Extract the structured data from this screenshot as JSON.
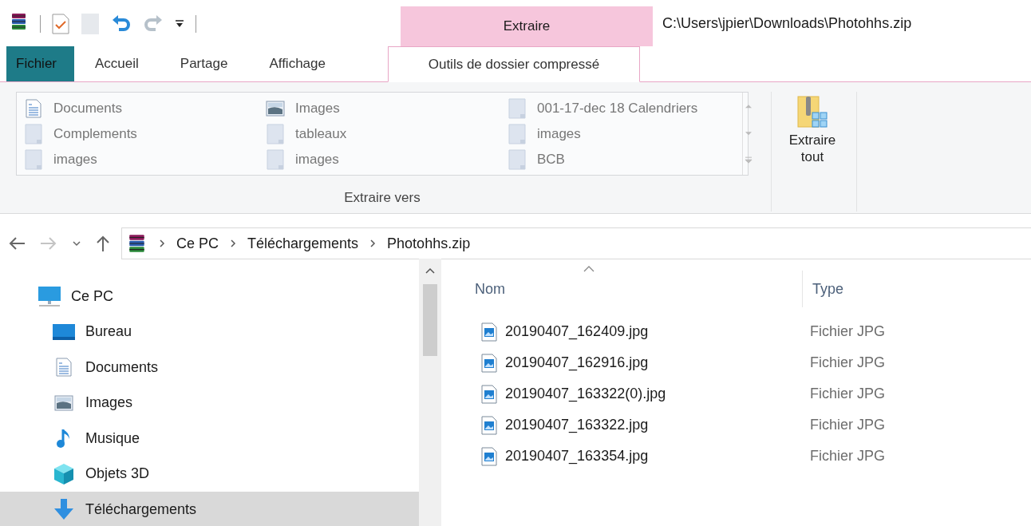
{
  "quick_access": [
    {
      "kind": "archive",
      "disabled": false
    },
    {
      "kind": "properties",
      "disabled": false
    },
    {
      "kind": "page",
      "disabled": true
    },
    {
      "kind": "undo",
      "disabled": false
    },
    {
      "kind": "redo",
      "disabled": true
    },
    {
      "kind": "customize",
      "disabled": false
    }
  ],
  "context_tab_group": "Extraire",
  "window": {
    "title": "C:\\Users\\jpier\\Downloads\\Photohhs.zip"
  },
  "tabs": [
    {
      "label": "Fichier",
      "kind": "file",
      "selected": false
    },
    {
      "label": "Accueil",
      "kind": "tab",
      "selected": false
    },
    {
      "label": "Partage",
      "kind": "tab",
      "selected": false
    },
    {
      "label": "Affichage",
      "kind": "tab",
      "selected": false
    },
    {
      "label": "Outils de dossier compressé",
      "kind": "context",
      "selected": true
    }
  ],
  "ribbon": {
    "gallery": [
      [
        {
          "label": "Documents",
          "kind": "documents"
        },
        {
          "label": "Complements",
          "kind": "folder"
        },
        {
          "label": "images",
          "kind": "folder"
        }
      ],
      [
        {
          "label": "Images",
          "kind": "images"
        },
        {
          "label": "tableaux",
          "kind": "folder"
        },
        {
          "label": "images",
          "kind": "folder"
        }
      ],
      [
        {
          "label": "001-17-dec 18 Calendriers",
          "kind": "folder"
        },
        {
          "label": "images",
          "kind": "folder"
        },
        {
          "label": "BCB",
          "kind": "folder"
        }
      ]
    ],
    "group_label": "Extraire vers",
    "extract_all": "Extraire tout"
  },
  "navigation": [
    {
      "kind": "back",
      "disabled": false
    },
    {
      "kind": "forward",
      "disabled": true
    },
    {
      "kind": "recent",
      "disabled": false
    },
    {
      "kind": "up",
      "disabled": false
    }
  ],
  "breadcrumb": [
    "Ce PC",
    "Téléchargements",
    "Photohhs.zip"
  ],
  "sidebar": {
    "items": [
      {
        "label": "Ce PC",
        "kind": "pc",
        "selected": false,
        "children": [
          {
            "label": "Bureau",
            "kind": "desktop",
            "selected": false
          },
          {
            "label": "Documents",
            "kind": "documents",
            "selected": false
          },
          {
            "label": "Images",
            "kind": "images",
            "selected": false
          },
          {
            "label": "Musique",
            "kind": "music",
            "selected": false
          },
          {
            "label": "Objets 3D",
            "kind": "objects3d",
            "selected": false
          },
          {
            "label": "Téléchargements",
            "kind": "downloads",
            "selected": true
          }
        ]
      }
    ]
  },
  "table": {
    "columns": [
      {
        "label": "Nom",
        "sorted": true
      },
      {
        "label": "Type",
        "sorted": false
      }
    ],
    "rows": [
      {
        "name": "20190407_162409.jpg",
        "type": "Fichier JPG"
      },
      {
        "name": "20190407_162916.jpg",
        "type": "Fichier JPG"
      },
      {
        "name": "20190407_163322(0).jpg",
        "type": "Fichier JPG"
      },
      {
        "name": "20190407_163322.jpg",
        "type": "Fichier JPG"
      },
      {
        "name": "20190407_163354.jpg",
        "type": "Fichier JPG"
      }
    ]
  }
}
